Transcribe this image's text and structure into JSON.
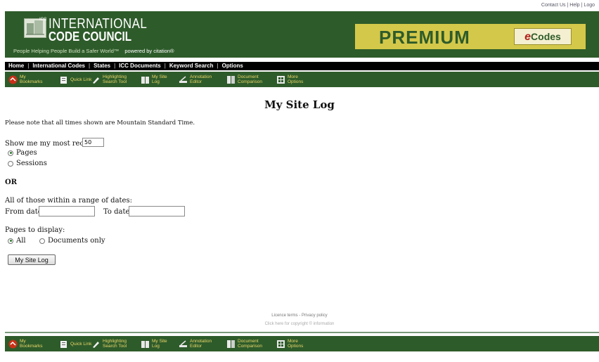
{
  "top_links": {
    "contact": "Contact Us",
    "help": "Help",
    "logout": "Logo"
  },
  "banner": {
    "title_line1": "INTERNATIONAL",
    "title_line2": "CODE COUNCIL",
    "logo_mark": "ICC",
    "tagline": "People Helping People Build a Safer World™",
    "powered_by": "powered by citation®",
    "premium": "PREMIUM",
    "ecodes_e": "e",
    "ecodes_rest": "Codes"
  },
  "nav": [
    "Home",
    "International Codes",
    "States",
    "ICC Documents",
    "Keyword Search",
    "Options"
  ],
  "toolbar": [
    {
      "label": "My Bookmarks",
      "icon": "bookmark-icon"
    },
    {
      "label": "Quick Link",
      "icon": "quick-link-icon"
    },
    {
      "label": "Highlighting Search Tool",
      "icon": "highlight-icon"
    },
    {
      "label": "My Site Log",
      "icon": "site-log-icon"
    },
    {
      "label": "Annotation Editor",
      "icon": "annotation-icon"
    },
    {
      "label": "Document Comparison",
      "icon": "compare-icon"
    },
    {
      "label": "More Options",
      "icon": "more-options-icon"
    }
  ],
  "page": {
    "title": "My Site Log",
    "note": "Please note that all times shown are Mountain Standard Time.",
    "show_recent_label": "Show me my most recent",
    "show_recent_value": "50",
    "pages_label": "Pages",
    "sessions_label": "Sessions",
    "or_label": "OR",
    "range_label": "All of those within a range of dates:",
    "from_label": "From date",
    "to_label": "To date",
    "from_value": "",
    "to_value": "",
    "pages_display_label": "Pages to display:",
    "all_label": "All",
    "docs_only_label": "Documents only",
    "submit_label": "My Site Log",
    "recent_selected": "Pages",
    "display_selected": "All"
  },
  "footer": {
    "licence_terms": "Licence terms",
    "privacy_policy": "Privacy policy",
    "copyright": "Click here for copyright © information"
  },
  "colors": {
    "banner_green": "#2e5b2a",
    "toolbar_text": "#e8d76a",
    "premium_bg": "#d4c84a",
    "nav_bg": "#000000"
  }
}
